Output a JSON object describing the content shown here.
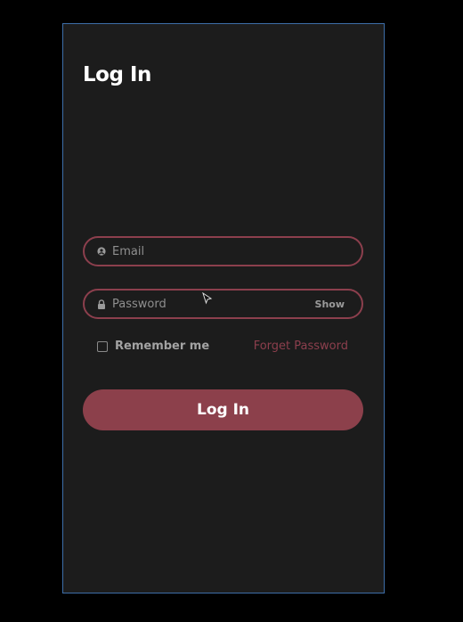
{
  "title": "Log In",
  "email": {
    "placeholder": "Email",
    "icon": "user-icon"
  },
  "password": {
    "placeholder": "Password",
    "icon": "lock-icon",
    "show_label": "Show"
  },
  "remember": {
    "label": "Remember me",
    "checked": false
  },
  "forget_password_label": "Forget Password",
  "login_button_label": "Log In",
  "colors": {
    "accent": "#8c404b",
    "panel_background": "#1c1c1c",
    "page_background": "#000000",
    "frame_border": "#3d6ea8"
  }
}
